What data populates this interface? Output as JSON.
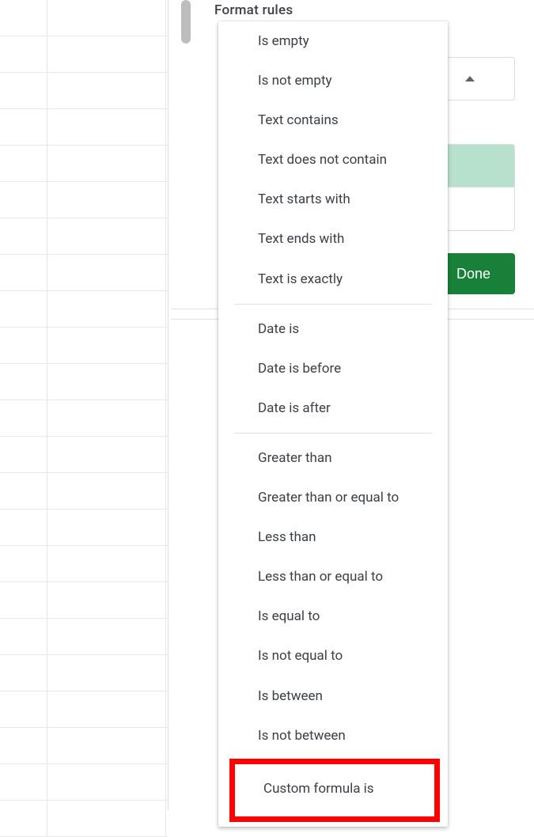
{
  "sidebar": {
    "heading": "Format rules",
    "done_label": "Done"
  },
  "dropdown": {
    "group1": [
      "Is empty",
      "Is not empty",
      "Text contains",
      "Text does not contain",
      "Text starts with",
      "Text ends with",
      "Text is exactly"
    ],
    "group2": [
      "Date is",
      "Date is before",
      "Date is after"
    ],
    "group3": [
      "Greater than",
      "Greater than or equal to",
      "Less than",
      "Less than or equal to",
      "Is equal to",
      "Is not equal to",
      "Is between",
      "Is not between"
    ],
    "highlighted": "Custom formula is"
  }
}
